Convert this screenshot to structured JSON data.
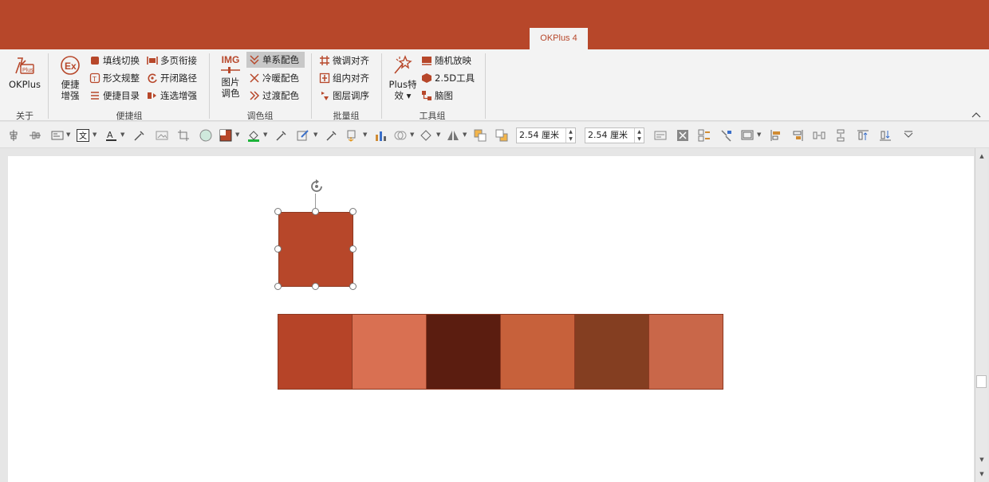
{
  "ribbon_tab": "OKPlus 4",
  "groups": {
    "about": {
      "label": "关于",
      "okplus": "OKPlus"
    },
    "quick": {
      "label": "便捷组",
      "big": [
        "便捷",
        "增强"
      ],
      "items": [
        "填线切换",
        "形文规整",
        "便捷目录",
        "多页衔接",
        "开闭路径",
        "连选增强"
      ]
    },
    "color": {
      "label": "调色组",
      "img_logo": "IMG",
      "big": [
        "图片",
        "调色"
      ],
      "items": [
        "单系配色",
        "冷暖配色",
        "过渡配色"
      ]
    },
    "batch": {
      "label": "批量组",
      "items": [
        "微调对齐",
        "组内对齐",
        "图层调序"
      ]
    },
    "tools": {
      "label": "工具组",
      "big": [
        "Plus特",
        "效 ▾"
      ],
      "items": [
        "随机放映",
        "2.5D工具",
        "脑图"
      ]
    }
  },
  "size_fields": {
    "height": "2.54 厘米",
    "width": "2.54 厘米"
  },
  "colors": {
    "brand": "#b7472a",
    "palette": [
      "#b64428",
      "#d97052",
      "#5b1d10",
      "#c7613b",
      "#843e21",
      "#c96749"
    ]
  },
  "icons": {
    "rotate": "rotate-icon",
    "collapse": "chevron-up-icon"
  }
}
